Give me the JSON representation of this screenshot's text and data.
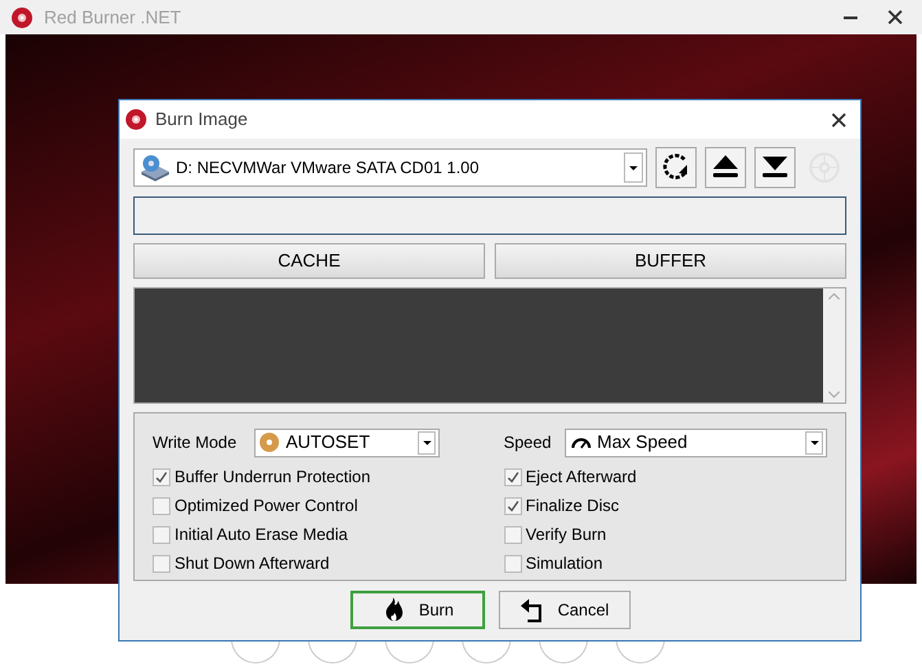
{
  "main_window": {
    "title": "Red Burner .NET"
  },
  "dialog": {
    "title": "Burn Image",
    "drive": {
      "value": "D: NECVMWar VMware SATA CD01 1.00"
    },
    "drive_buttons": [
      {
        "kind": "refresh",
        "disabled": false
      },
      {
        "kind": "eject",
        "disabled": false
      },
      {
        "kind": "load",
        "disabled": false
      },
      {
        "kind": "erase",
        "disabled": true
      }
    ],
    "progress": {
      "level": 0
    },
    "tabs": [
      {
        "label": "CACHE"
      },
      {
        "label": "BUFFER"
      }
    ],
    "write_mode": {
      "label": "Write Mode",
      "value": "AUTOSET"
    },
    "speed": {
      "label": "Speed",
      "value": "Max Speed"
    },
    "options_left": [
      {
        "label": "Buffer Underrun Protection",
        "checked": true
      },
      {
        "label": "Optimized Power Control",
        "checked": false
      },
      {
        "label": "Initial Auto Erase Media",
        "checked": false
      },
      {
        "label": "Shut Down Afterward",
        "checked": false
      }
    ],
    "options_right": [
      {
        "label": "Eject Afterward",
        "checked": true
      },
      {
        "label": "Finalize Disc",
        "checked": true
      },
      {
        "label": "Verify Burn",
        "checked": false
      },
      {
        "label": "Simulation",
        "checked": false
      }
    ],
    "buttons": [
      {
        "kind": "burn",
        "label": "Burn",
        "default": true
      },
      {
        "kind": "cancel",
        "label": "Cancel",
        "default": false
      }
    ]
  }
}
